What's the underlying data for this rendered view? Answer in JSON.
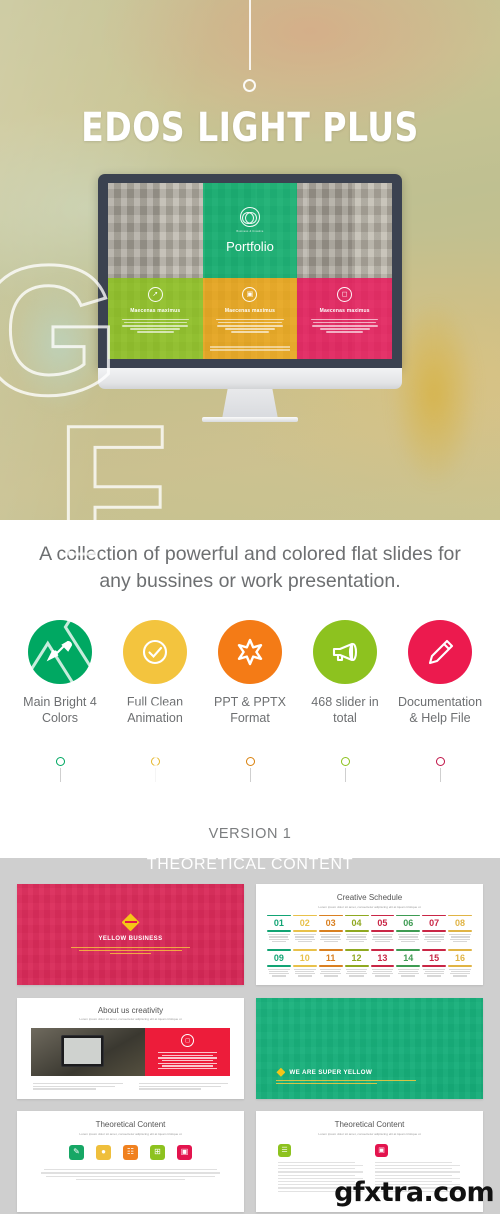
{
  "hero": {
    "title": "EDOS LIGHT PLUS",
    "monitor_slide": {
      "main_title": "Portfolio",
      "logo_caption": "Business & Creative",
      "panels": [
        {
          "heading": "Maecenas maximus",
          "icon": "compass-icon",
          "color": "#8BC318"
        },
        {
          "heading": "Maecenas maximus",
          "icon": "briefcase-icon",
          "color": "#F0A814"
        },
        {
          "heading": "Maecenas maximus",
          "icon": "camera-icon",
          "color": "#E9185A"
        }
      ],
      "top_panel_color": "#00B26B"
    }
  },
  "mid": {
    "tagline": "A collection of powerful and colored flat slides for any bussines or work presentation.",
    "features": [
      {
        "label": "Main Bright 4 Colors",
        "icon": "paintbrush-icon",
        "color": "#00A862"
      },
      {
        "label": "Full Clean Animation",
        "icon": "check-circle-icon",
        "color": "#F3C43E"
      },
      {
        "label": "PPT & PPTX Format",
        "icon": "asterisk-icon",
        "color": "#F47B16"
      },
      {
        "label": "468 slider in total",
        "icon": "megaphone-icon",
        "color": "#8DC21F"
      },
      {
        "label": "Documentation & Help File",
        "icon": "pencil-icon",
        "color": "#EC1A4E"
      }
    ],
    "version": "VERSION 1"
  },
  "bottom": {
    "band_title": "THEORETICAL CONTENT",
    "slides": [
      {
        "name": "yellow-business-slide",
        "title": "YELLOW BUSINESS",
        "subtitle": "Lorem ipsum dolor sit amet, consectetur adipiscing elit in lorem",
        "tint": "#E3144E"
      },
      {
        "name": "creative-schedule-slide",
        "title": "Creative Schedule",
        "subtitle": "Lorem ipsum dolor sit amet, consectetur adipiscing elit at lquam tristique ut",
        "numbers": [
          {
            "value": "01",
            "color": "#12A474"
          },
          {
            "value": "02",
            "color": "#E8C14A"
          },
          {
            "value": "03",
            "color": "#D98021"
          },
          {
            "value": "04",
            "color": "#8FA820"
          },
          {
            "value": "05",
            "color": "#C92645"
          },
          {
            "value": "06",
            "color": "#3E9B52"
          },
          {
            "value": "07",
            "color": "#C92645"
          },
          {
            "value": "08",
            "color": "#E0B445"
          },
          {
            "value": "09",
            "color": "#12A474"
          },
          {
            "value": "10",
            "color": "#E8C14A"
          },
          {
            "value": "11",
            "color": "#D98021"
          },
          {
            "value": "12",
            "color": "#8FA820"
          },
          {
            "value": "13",
            "color": "#C92645"
          },
          {
            "value": "14",
            "color": "#3E9B52"
          },
          {
            "value": "15",
            "color": "#C92645"
          },
          {
            "value": "16",
            "color": "#E0B445"
          }
        ]
      },
      {
        "name": "about-us-slide",
        "title": "About us creativity",
        "subtitle": "Lorem ipsum dolor sit amet, consectetur adipiscing elit at lquam tristique ut",
        "accent": "#ED1C3A"
      },
      {
        "name": "super-yellow-slide",
        "title": "WE ARE SUPER YELLOW",
        "subtitle": "Lorem ipsum dolor sit amet, consectetur adipiscing",
        "tint": "#00B276"
      },
      {
        "name": "theoretical-content-icons-slide",
        "title": "Theoretical Content",
        "subtitle": "Lorem ipsum dolor sit amet, consectetur adipiscing elit at lquam tristique ut",
        "icons": [
          {
            "icon": "pencil-square-icon",
            "color": "#16A765"
          },
          {
            "icon": "chat-icon",
            "color": "#EFBF3C"
          },
          {
            "icon": "chart-icon",
            "color": "#F0811F"
          },
          {
            "icon": "grid-icon",
            "color": "#8DC21F"
          },
          {
            "icon": "camera-icon",
            "color": "#E3144E"
          }
        ]
      },
      {
        "name": "theoretical-content-columns-slide",
        "title": "Theoretical Content",
        "subtitle": "Lorem ipsum dolor sit amet, consectetur adipiscing elit at lquam tristique ut",
        "icons": [
          {
            "icon": "book-icon",
            "color": "#8DC21F"
          },
          {
            "icon": "camera-icon",
            "color": "#E3144E"
          }
        ]
      }
    ]
  },
  "watermark": {
    "outline_text": "GFXTRA",
    "site_mark": "gfxtra.com"
  }
}
